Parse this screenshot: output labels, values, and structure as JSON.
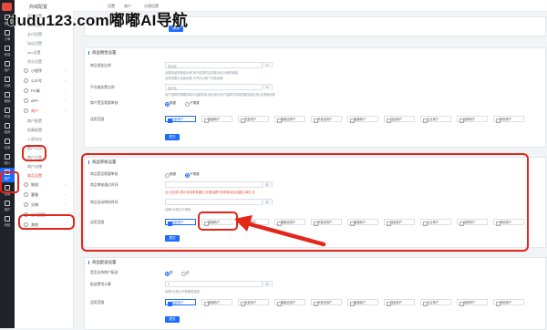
{
  "watermark": "dudu123.com嘟嘟AI导航",
  "sidebar_title": "商城配置",
  "crumbs": [
    "设置",
    "商户",
    "分佣设置"
  ],
  "iconbar": [
    {
      "label": "首页"
    },
    {
      "label": "订单"
    },
    {
      "label": "商品"
    },
    {
      "label": "用户"
    },
    {
      "label": "分销"
    },
    {
      "label": "营销"
    },
    {
      "label": "财务"
    },
    {
      "label": "装修"
    },
    {
      "label": "应用"
    },
    {
      "label": "统计"
    },
    {
      "label": "商户"
    },
    {
      "label": "设置"
    },
    {
      "label": "维护"
    },
    {
      "label": "系统"
    }
  ],
  "submenu": [
    {
      "label": "基础设置",
      "level": 2
    },
    {
      "label": "消息设置",
      "level": 2
    },
    {
      "label": "支付设置",
      "level": 2
    },
    {
      "label": "协议设置",
      "level": 2
    },
    {
      "label": "seo设置",
      "level": 2
    },
    {
      "label": "积分设置",
      "level": 2
    },
    {
      "label": "小程序",
      "level": 1
    },
    {
      "label": "公众号",
      "level": 1
    },
    {
      "label": "PC端",
      "level": 1
    },
    {
      "label": "APP",
      "level": 1
    },
    {
      "label": "商户",
      "level": 1,
      "highlighted": true
    },
    {
      "label": "商户配置",
      "level": 2
    },
    {
      "label": "结算配置",
      "level": 2
    },
    {
      "label": "入驻协议",
      "level": 2
    },
    {
      "label": "商户公告",
      "level": 2
    },
    {
      "label": "商户分类",
      "level": 2
    },
    {
      "label": "商户店铺",
      "level": 2
    },
    {
      "label": "商品设置",
      "level": 2,
      "highlighted": true
    },
    {
      "label": "物流",
      "level": 1
    },
    {
      "label": "客服",
      "level": 1
    },
    {
      "label": "分销",
      "level": 1
    },
    {
      "label": "自动回复",
      "level": 1
    },
    {
      "label": "其他",
      "level": 1
    }
  ],
  "top_section": {
    "save_label": "提交"
  },
  "section1": {
    "title": "商品佣金设置",
    "row1_label": "商品佣金比例",
    "row1_prefix": "百分比",
    "row1_suffix": "%",
    "row1_hint1": "设置商品的佣金比例,商户结算时会扣除对应比例的佣金",
    "row1_hint2": "此项设置为全局设置,不可针对单个商品设置",
    "row2_label": "平台服务费比例",
    "row2_prefix": "百分比",
    "row2_suffix": "%",
    "row2_hint": "商户结算时需要扣除平台服务费,该比例为商户结算时扣除的服务费比例,请谨慎设置",
    "row3_label": "商户是否需要审核",
    "row3_options": [
      "需要",
      "不需要"
    ],
    "row4_label": "适用范围",
    "row4_options": [
      "全部商户",
      "普通商户",
      "自营商户",
      "旗舰店商户",
      "专营店商户",
      "普通商户",
      "连锁商户",
      "企业商户",
      "品牌商户",
      "其他商户"
    ],
    "save_label": "提交"
  },
  "section2": {
    "title": "商品审核设置",
    "row1_label": "商品是否需要审核",
    "row1_options": [
      "需要",
      "不需要"
    ],
    "row2_label": "商品审核通过时间",
    "row2_suffix": "天",
    "row2_hint": "注:为空或0,表示自动审核通过,设置后超时未审核将自动通过,单位:天",
    "row3_label": "商品自动审核时间",
    "row3_suffix": "天",
    "row3_hint": "设置为0表示不审核",
    "row4_label": "适用范围",
    "row4_options": [
      "全部商户",
      "普通商户",
      "自营商户",
      "旗舰店商户",
      "专营店商户",
      "普通商户",
      "连锁商户",
      "企业商户",
      "品牌商户",
      "其他商户"
    ],
    "save_label": "提交"
  },
  "section3": {
    "title": "商品配送设置",
    "row1_label": "是否支持商户配送",
    "row1_options": [
      "是",
      "否"
    ],
    "row2_label": "配送费用计算",
    "row2_value": "0",
    "row2_suffix": "元",
    "row2_hint": "设置为0表示不收取配送费",
    "row3_label": "适用范围",
    "row3_options": [
      "全部商户",
      "普通商户",
      "自营商户",
      "旗舰店商户",
      "专营店商户",
      "普通商户",
      "连锁商户",
      "企业商户",
      "品牌商户",
      "其他商户"
    ],
    "save_label": "提交"
  },
  "colors": {
    "accent": "#1e6bff",
    "highlight": "#e3251a",
    "sidebar_dark": "#1f2329"
  }
}
